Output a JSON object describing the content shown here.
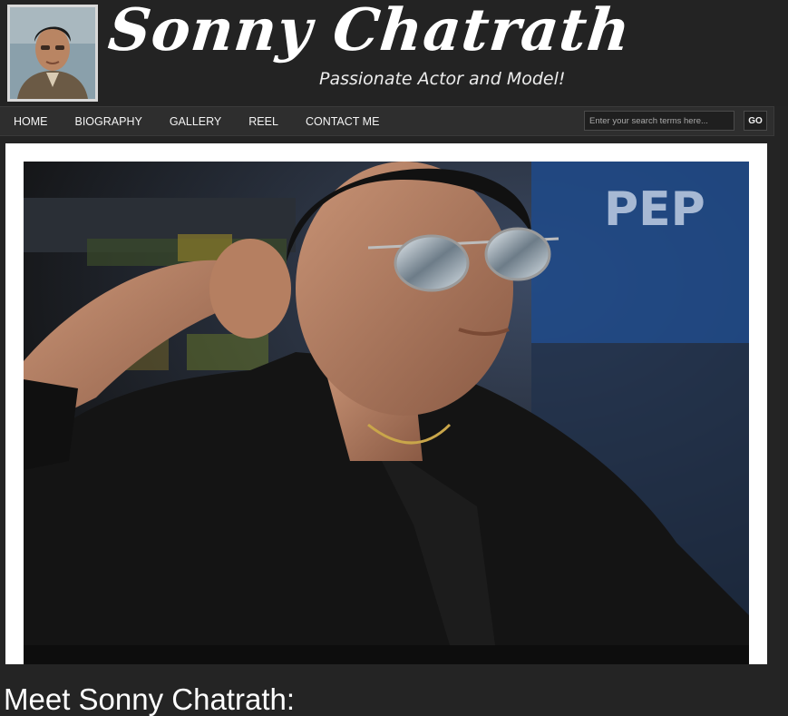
{
  "header": {
    "site_title": "Sonny Chatrath",
    "tagline": "Passionate Actor and Model!"
  },
  "nav": {
    "items": [
      {
        "label": "HOME"
      },
      {
        "label": "BIOGRAPHY"
      },
      {
        "label": "GALLERY"
      },
      {
        "label": "REEL"
      },
      {
        "label": "CONTACT ME"
      }
    ]
  },
  "search": {
    "placeholder": "Enter your search terms here...",
    "value": "",
    "button_label": "GO"
  },
  "main": {
    "heading": "Meet Sonny Chatrath:"
  },
  "colors": {
    "page_background": "#242424",
    "nav_background": "#2e2e2e",
    "photo_frame": "#ffffff",
    "text": "#ffffff"
  }
}
